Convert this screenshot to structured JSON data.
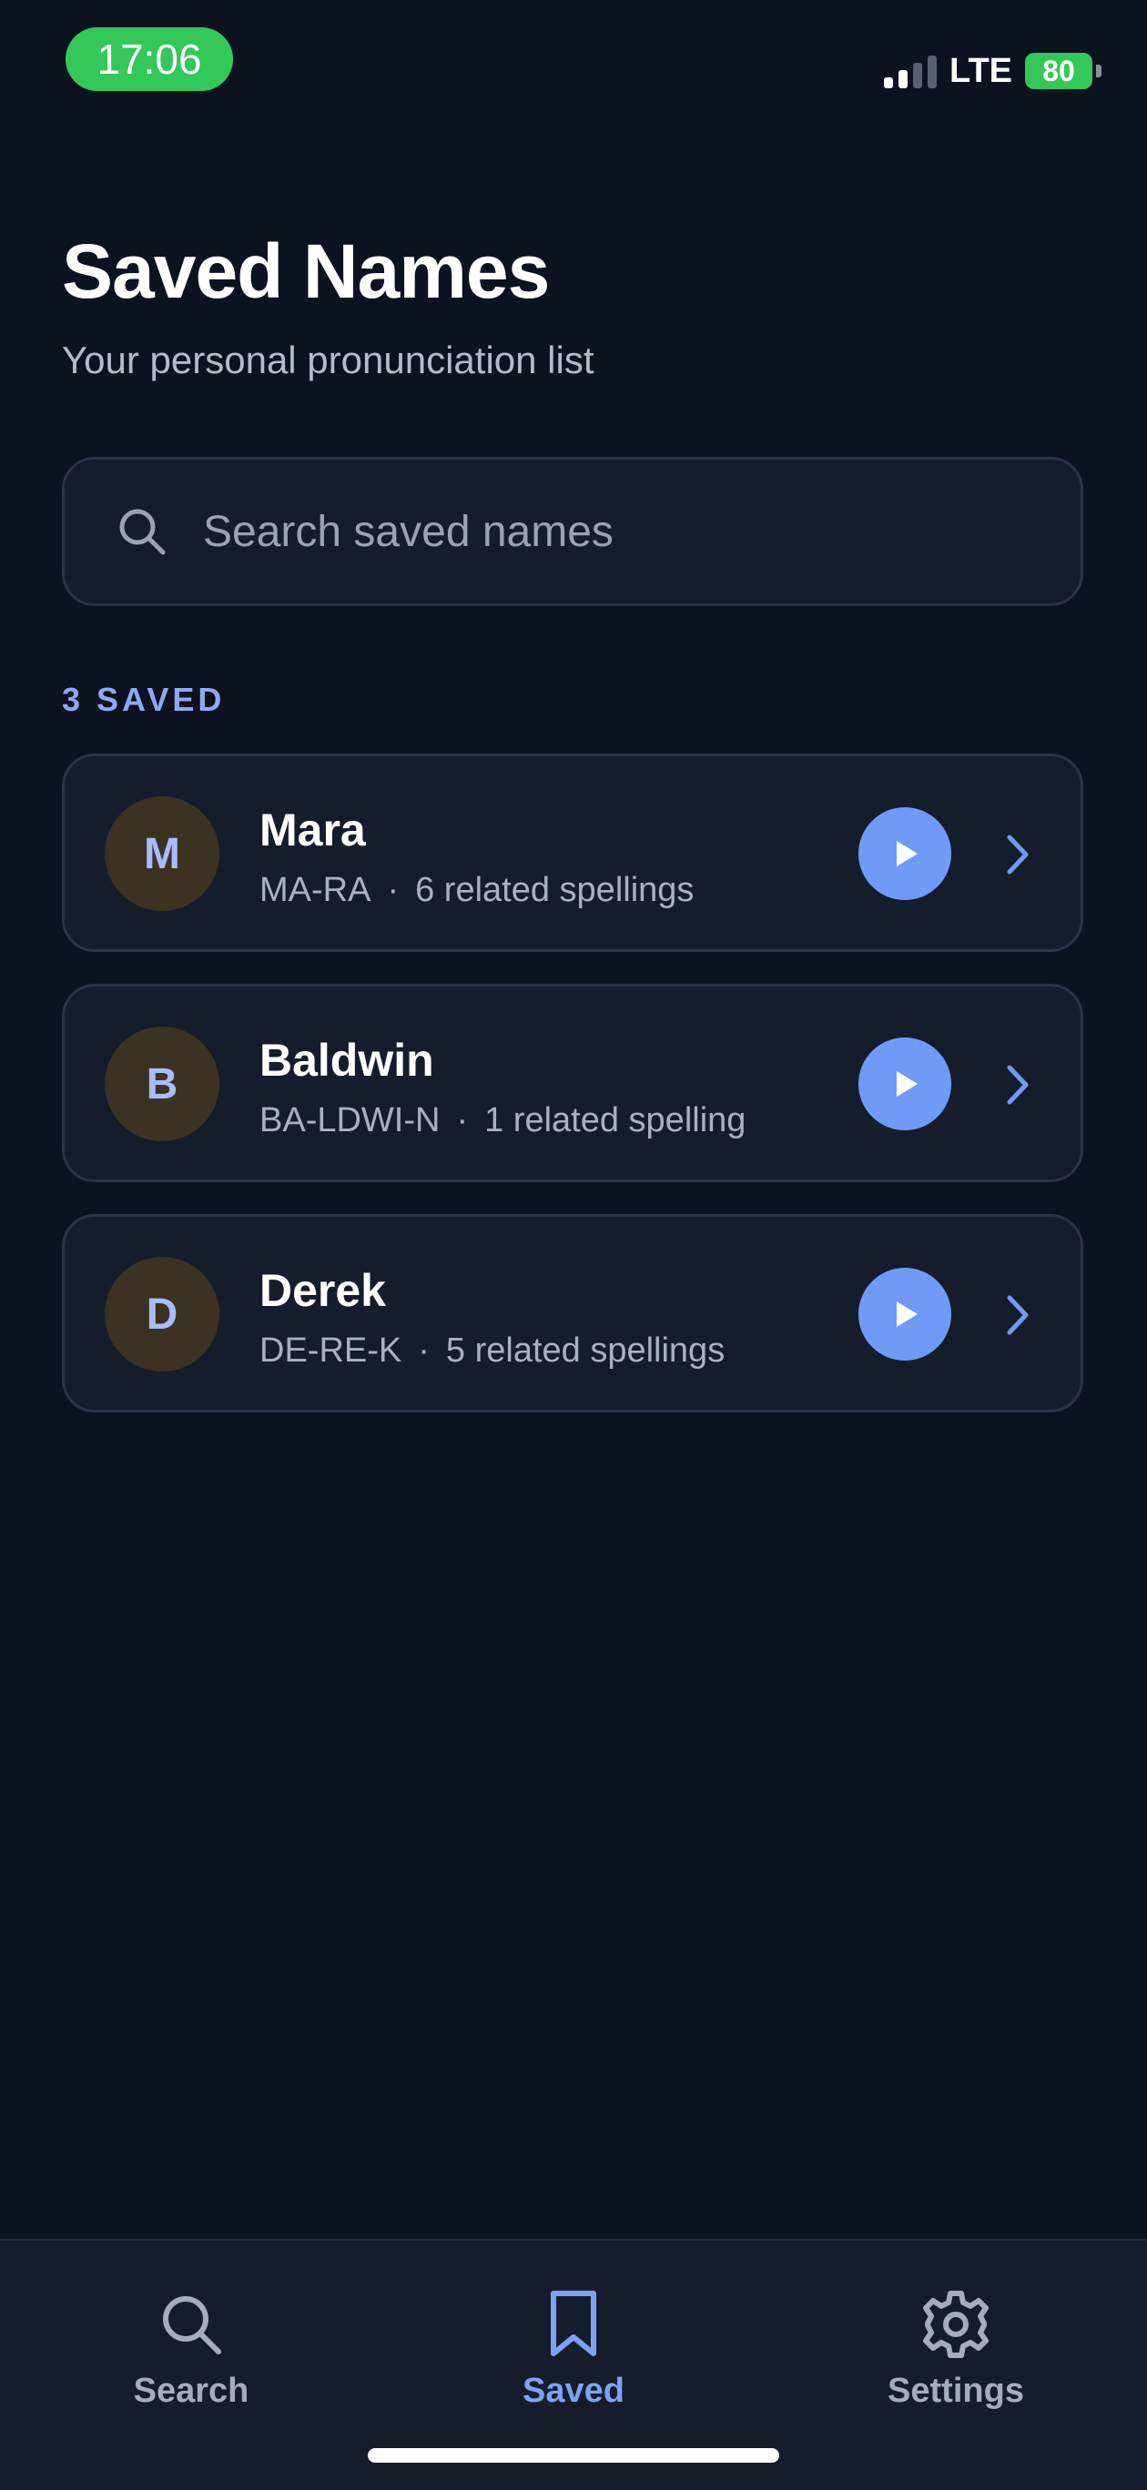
{
  "status_bar": {
    "time": "17:06",
    "network": "LTE",
    "battery": "80"
  },
  "header": {
    "title": "Saved Names",
    "subtitle": "Your personal pronunciation list"
  },
  "search": {
    "placeholder": "Search saved names",
    "value": ""
  },
  "section": {
    "label": "3 SAVED"
  },
  "saved_names": [
    {
      "initial": "M",
      "name": "Mara",
      "pronunciation": "MA-RA",
      "separator": "·",
      "related": "6 related spellings"
    },
    {
      "initial": "B",
      "name": "Baldwin",
      "pronunciation": "BA-LDWI-N",
      "separator": "·",
      "related": "1 related spelling"
    },
    {
      "initial": "D",
      "name": "Derek",
      "pronunciation": "DE-RE-K",
      "separator": "·",
      "related": "5 related spellings"
    }
  ],
  "tab_bar": {
    "tabs": [
      {
        "label": "Search",
        "icon": "search-icon",
        "active": false
      },
      {
        "label": "Saved",
        "icon": "bookmark-icon",
        "active": true
      },
      {
        "label": "Settings",
        "icon": "gear-icon",
        "active": false
      }
    ]
  },
  "colors": {
    "background": "#0c1220",
    "card": "#151d2d",
    "accent": "#6f9bf7",
    "status_green": "#34c759"
  }
}
